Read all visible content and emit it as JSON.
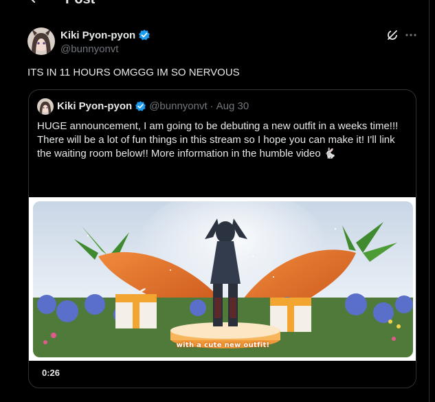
{
  "header": {
    "title": "Post"
  },
  "post": {
    "author_name": "Kiki Pyon-pyon",
    "author_handle": "@bunnyonvt",
    "text": "ITS IN 11 HOURS OMGGG IM SO NERVOUS"
  },
  "quote": {
    "author_name": "Kiki Pyon-pyon",
    "author_handle": "@bunnyonvt",
    "separator": "·",
    "date": "Aug 30",
    "text": "HUGE announcement, I am going to be debuting a new outfit in a weeks time!!! There will be a lot of fun things in this stream so I hope you can make it! I'll link the waiting room below!! More information in the humble video 🐇",
    "video": {
      "caption": "with a cute new outfit!",
      "duration": "0:26"
    }
  },
  "colors": {
    "background": "#000000",
    "text": "#e7e9ea",
    "muted": "#71767b",
    "border": "#2f3336",
    "verified": "#1d9bf0"
  }
}
